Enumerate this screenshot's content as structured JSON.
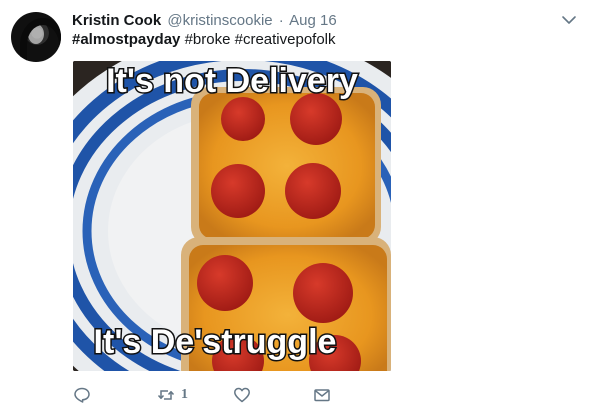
{
  "tweet": {
    "author_name": "Kristin Cook",
    "author_handle": "@kristinscookie",
    "separator": "·",
    "date": "Aug 16",
    "hashtags": [
      "#almostpayday",
      "#broke",
      "#creativepofolk"
    ],
    "media": {
      "caption_top": "It's not Delivery",
      "caption_bottom": "It's De'struggle"
    },
    "actions": {
      "retweet_count": "1"
    }
  },
  "icons": {
    "caret": "chevron-down-icon",
    "reply": "reply-icon",
    "retweet": "retweet-icon",
    "like": "heart-icon",
    "dm": "envelope-icon"
  },
  "colors": {
    "text": "#14171a",
    "secondary": "#657786",
    "plate_blue": "#1f54a8"
  }
}
